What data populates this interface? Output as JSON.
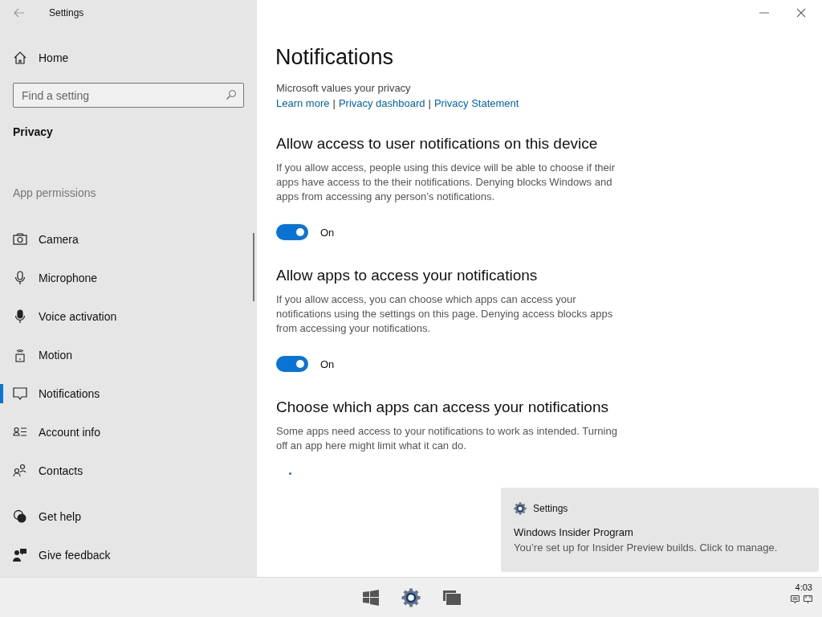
{
  "window": {
    "title": "Settings"
  },
  "sidebar": {
    "home": "Home",
    "search": {
      "placeholder": "Find a setting"
    },
    "section": "Privacy",
    "group": "App permissions",
    "items": [
      {
        "label": "Camera",
        "selected": false
      },
      {
        "label": "Microphone",
        "selected": false
      },
      {
        "label": "Voice activation",
        "selected": false
      },
      {
        "label": "Motion",
        "selected": false
      },
      {
        "label": "Notifications",
        "selected": true
      },
      {
        "label": "Account info",
        "selected": false
      },
      {
        "label": "Contacts",
        "selected": false
      }
    ],
    "footer": [
      "Get help",
      "Give feedback"
    ]
  },
  "main": {
    "title": "Notifications",
    "privacy_text": "Microsoft values your privacy",
    "privacy_links": [
      {
        "kind": "link",
        "text": "Learn more"
      },
      {
        "kind": "separator",
        "text": "|"
      },
      {
        "kind": "link",
        "text": "Privacy dashboard"
      },
      {
        "kind": "separator",
        "text": "|"
      },
      {
        "kind": "link",
        "text": "Privacy Statement"
      }
    ],
    "sections": [
      {
        "heading": "Allow access to user notifications on this device",
        "description": "If you allow access, people using this device will be able to choose if their apps have access to the their notifications. Denying blocks Windows and apps from accessing any person’s notifications.",
        "toggle": {
          "on": true,
          "label": "On"
        }
      },
      {
        "heading": "Allow apps to access your notifications",
        "description": "If you allow access, you can choose which apps can access your notifications using the settings on this page. Denying access blocks apps from accessing your notifications.",
        "toggle": {
          "on": true,
          "label": "On"
        }
      },
      {
        "heading": "Choose which apps can access your notifications",
        "description": "Some apps need access to your notifications to work as intended. Turning off an app here might limit what it can do.",
        "loading": true
      }
    ]
  },
  "toast": {
    "app": "Settings",
    "title": "Windows Insider Program",
    "body": "You’re set up for Insider Preview builds. Click to manage."
  },
  "taskbar": {
    "clock": "4:03"
  }
}
